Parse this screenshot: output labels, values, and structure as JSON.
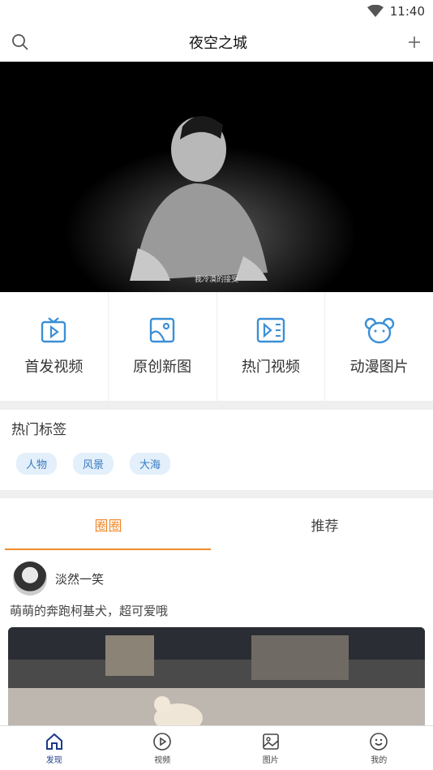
{
  "status": {
    "time": "11:40"
  },
  "header": {
    "title": "夜空之城"
  },
  "banner": {
    "caption": "我冷漠的接受"
  },
  "quick_links": [
    {
      "label": "首发视频",
      "icon": "tv-play-icon"
    },
    {
      "label": "原创新图",
      "icon": "picture-icon"
    },
    {
      "label": "热门视频",
      "icon": "video-list-icon"
    },
    {
      "label": "动漫图片",
      "icon": "bear-icon"
    }
  ],
  "hot_tags": {
    "title": "热门标签",
    "tags": [
      "人物",
      "风景",
      "大海"
    ]
  },
  "tabs": [
    {
      "label": "圈圈"
    },
    {
      "label": "推荐"
    }
  ],
  "post": {
    "user": "淡然一笑",
    "text": "萌萌的奔跑柯基犬，超可爱哦"
  },
  "bottom_nav": [
    {
      "label": "发现"
    },
    {
      "label": "视频"
    },
    {
      "label": "图片"
    },
    {
      "label": "我的"
    }
  ],
  "colors": {
    "accent": "#f08a2a",
    "icon_blue": "#3b8fd6",
    "nav_active": "#1b3a8a"
  }
}
